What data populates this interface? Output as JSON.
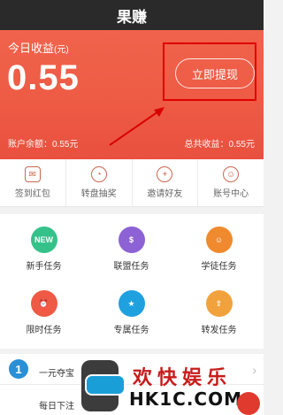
{
  "app": {
    "title": "果赚"
  },
  "hero": {
    "label": "今日收益",
    "label_unit": "(元)",
    "amount": "0.55",
    "withdraw_label": "立即提现",
    "balance": "账户余额：0.55元",
    "total": "总共收益：0.55元"
  },
  "shortcuts": [
    {
      "label": "签到红包",
      "icon": "gift-icon"
    },
    {
      "label": "转盘抽奖",
      "icon": "wheel-icon"
    },
    {
      "label": "邀请好友",
      "icon": "add-friend-icon"
    },
    {
      "label": "账号中心",
      "icon": "user-icon"
    }
  ],
  "tasks": [
    {
      "label": "新手任务",
      "badge": "NEW",
      "color": "#35c28a",
      "icon": "new-icon"
    },
    {
      "label": "联盟任务",
      "badge": "$",
      "color": "#8d62d4",
      "icon": "money-bag-icon"
    },
    {
      "label": "学徒任务",
      "badge": "☺",
      "color": "#f08a2e",
      "icon": "apprentice-icon"
    },
    {
      "label": "限时任务",
      "badge": "⏰",
      "color": "#ee5a44",
      "icon": "alarm-icon"
    },
    {
      "label": "专属任务",
      "badge": "★",
      "color": "#1fa1e0",
      "icon": "star-icon"
    },
    {
      "label": "转发任务",
      "badge": "⇪",
      "color": "#f2a23c",
      "icon": "share-icon"
    }
  ],
  "promo": {
    "row1_num": "1",
    "row1_text": "一元夺宝",
    "row2_text": "每日下注"
  },
  "watermark": {
    "cn": "欢快娱乐",
    "url": "HK1C.COM"
  }
}
